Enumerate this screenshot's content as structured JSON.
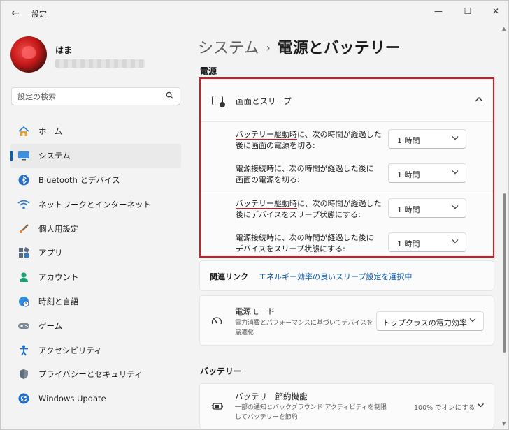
{
  "window": {
    "title": "設定",
    "back_glyph": "←",
    "min_glyph": "—",
    "max_glyph": "☐",
    "close_glyph": "✕"
  },
  "profile": {
    "name": "はま",
    "email": "••••••••••••••••"
  },
  "search": {
    "placeholder": "設定の検索",
    "icon": "search-icon"
  },
  "sidebar": {
    "items": [
      {
        "label": "ホーム",
        "icon": "home-icon",
        "active": false
      },
      {
        "label": "システム",
        "icon": "monitor-icon",
        "active": true
      },
      {
        "label": "Bluetooth とデバイス",
        "icon": "bluetooth-icon",
        "active": false
      },
      {
        "label": "ネットワークとインターネット",
        "icon": "wifi-icon",
        "active": false
      },
      {
        "label": "個人用設定",
        "icon": "brush-icon",
        "active": false
      },
      {
        "label": "アプリ",
        "icon": "apps-icon",
        "active": false
      },
      {
        "label": "アカウント",
        "icon": "person-icon",
        "active": false
      },
      {
        "label": "時刻と言語",
        "icon": "globe-clock-icon",
        "active": false
      },
      {
        "label": "ゲーム",
        "icon": "gamepad-icon",
        "active": false
      },
      {
        "label": "アクセシビリティ",
        "icon": "accessibility-icon",
        "active": false
      },
      {
        "label": "プライバシーとセキュリティ",
        "icon": "shield-icon",
        "active": false
      },
      {
        "label": "Windows Update",
        "icon": "update-icon",
        "active": false
      }
    ]
  },
  "breadcrumb": {
    "parent": "システム",
    "separator": "›",
    "current": "電源とバッテリー"
  },
  "power_section": {
    "title": "電源",
    "screen_sleep": {
      "title": "画面とスリープ",
      "rows": [
        {
          "line1_underlined": "バッテリー駆動時",
          "line1_rest": "に、次の時間が経過した",
          "line2": "後に画面の電源を切る:",
          "value": "1 時間"
        },
        {
          "line1_underlined": "",
          "line1_rest": "電源接続時に、次の時間が経過した後に",
          "line2": "画面の電源を切る:",
          "value": "1 時間"
        },
        {
          "line1_underlined": "バッテリー駆動時",
          "line1_rest": "に、次の時間が経過した",
          "line2": "後にデバイスをスリープ状態にする:",
          "value": "1 時間"
        },
        {
          "line1_underlined": "",
          "line1_rest": "電源接続時に、次の時間が経過した後に",
          "line2": "デバイスをスリープ状態にする:",
          "value": "1 時間"
        }
      ]
    },
    "related": {
      "label": "関連リンク",
      "link": "エネルギー効率の良いスリープ設定を選択中"
    },
    "power_mode": {
      "title": "電源モード",
      "description": "電力消費とパフォーマンスに基づいてデバイスを最適化",
      "value": "トップクラスの電力効率"
    }
  },
  "battery_section": {
    "title": "バッテリー",
    "saver": {
      "title": "バッテリー節約機能",
      "description": "一部の通知とバックグラウンド アクティビティを制限してバッテリーを節約",
      "status": "100% でオンにする"
    }
  },
  "colors": {
    "accent": "#005fb8",
    "highlight_red": "#e0151b",
    "link": "#0a5cb8"
  }
}
